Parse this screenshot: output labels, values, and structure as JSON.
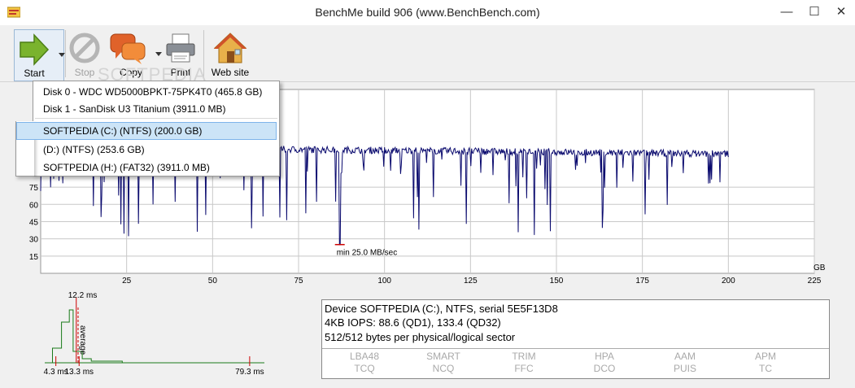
{
  "window": {
    "title": "BenchMe build 906 (www.BenchBench.com)",
    "min_glyph": "—",
    "max_glyph": "☐",
    "close_glyph": "✕"
  },
  "toolbar": {
    "start_label": "Start",
    "stop_label": "Stop",
    "copy_label": "Copy",
    "print_label": "Print",
    "website_label": "Web site",
    "watermark": "SOFTPEDIA"
  },
  "dropdown": {
    "items": [
      "Disk 0 - WDC WD5000BPKT-75PK4T0 (465.8 GB)",
      "Disk 1 - SanDisk U3 Titanium (3911.0 MB)",
      "SOFTPEDIA (C:) (NTFS) (200.0 GB)",
      "(D:) (NTFS) (253.6 GB)",
      "SOFTPEDIA (H:) (FAT32) (3911.0 MB)"
    ],
    "selected_index": 2
  },
  "chart_data": [
    {
      "type": "line",
      "x_unit": "GB",
      "x_ticks": [
        25,
        50,
        75,
        100,
        125,
        150,
        175,
        200,
        225
      ],
      "y_ticks": [
        15,
        30,
        45,
        60,
        75
      ],
      "xlim": [
        0,
        225
      ],
      "ylim": [
        0,
        160
      ],
      "x_range_of_data": [
        0,
        200
      ],
      "typical_rate_mb_s": 110,
      "annotation": "min 25.0 MB/sec",
      "min_value": 25.0,
      "min_at_gb": 87,
      "grid": true
    },
    {
      "type": "histogram",
      "peak_label": "12.2 ms",
      "average_label": "average",
      "x_labels": [
        "4.3 ms",
        "13.3 ms",
        "79.3 ms"
      ],
      "x_values_ms": [
        4.3,
        13.3,
        79.3
      ],
      "peak_ms": 12.2
    }
  ],
  "info": {
    "line1": "Device SOFTPEDIA (C:), NTFS,  serial 5E5F13D8",
    "line2": "4KB IOPS: 88.6 (QD1), 133.4 (QD32)",
    "line3": "512/512 bytes per physical/logical sector",
    "features": [
      {
        "top": "LBA48",
        "bottom": "TCQ"
      },
      {
        "top": "SMART",
        "bottom": "NCQ"
      },
      {
        "top": "TRIM",
        "bottom": "FFC"
      },
      {
        "top": "HPA",
        "bottom": "DCO"
      },
      {
        "top": "AAM",
        "bottom": "PUIS"
      },
      {
        "top": "APM",
        "bottom": "TC"
      }
    ]
  },
  "colors": {
    "series": "#0a0a6e",
    "min_marker": "#cc0000",
    "grid": "#c8c8c8",
    "start_arrow": "#7ab32e",
    "copy_bubble": "#e0622a"
  }
}
